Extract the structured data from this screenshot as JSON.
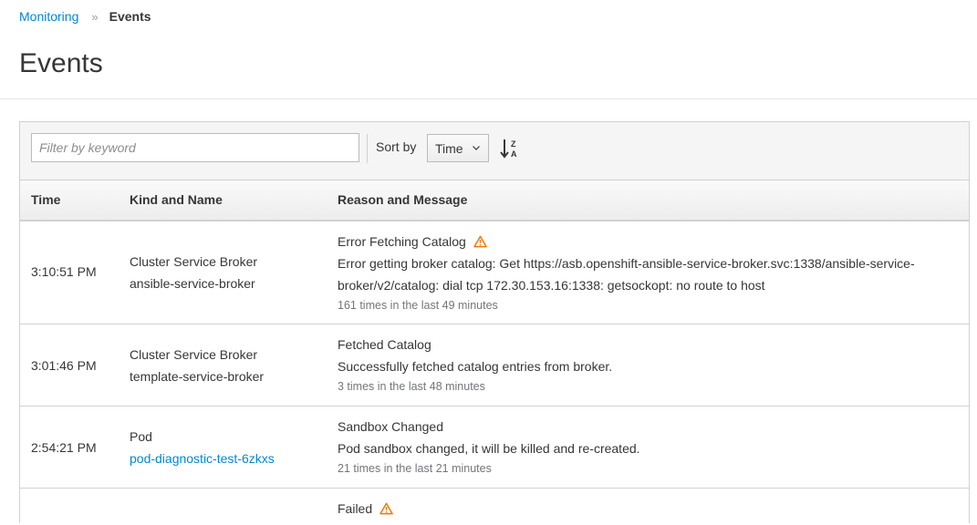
{
  "breadcrumb": {
    "parent": "Monitoring",
    "current": "Events"
  },
  "page_title": "Events",
  "toolbar": {
    "filter_placeholder": "Filter by keyword",
    "sort_label": "Sort by",
    "sort_value": "Time"
  },
  "table": {
    "headers": [
      "Time",
      "Kind and Name",
      "Reason and Message"
    ],
    "rows": [
      {
        "time": "3:10:51 PM",
        "kind": "Cluster Service Broker",
        "name": "ansible-service-broker",
        "reason": "Error Fetching Catalog",
        "warning": true,
        "message": "Error getting broker catalog: Get https://asb.openshift-ansible-service-broker.svc:1338/ansible-service-broker/v2/catalog: dial tcp 172.30.153.16:1338: getsockopt: no route to host",
        "count": "161 times in the last 49 minutes"
      },
      {
        "time": "3:01:46 PM",
        "kind": "Cluster Service Broker",
        "name": "template-service-broker",
        "reason": "Fetched Catalog",
        "warning": false,
        "message": "Successfully fetched catalog entries from broker.",
        "count": "3 times in the last 48 minutes"
      },
      {
        "time": "2:54:21 PM",
        "kind": "Pod",
        "name": "pod-diagnostic-test-6zkxs",
        "reason": "Sandbox Changed",
        "warning": false,
        "message": "Pod sandbox changed, it will be killed and re-created.",
        "count": "21 times in the last 21 minutes"
      },
      {
        "reason": "Failed",
        "warning": true
      }
    ]
  },
  "colors": {
    "link": "#0088ce",
    "warning": "#ec7a08",
    "text": "#363636",
    "muted": "#72767b"
  }
}
